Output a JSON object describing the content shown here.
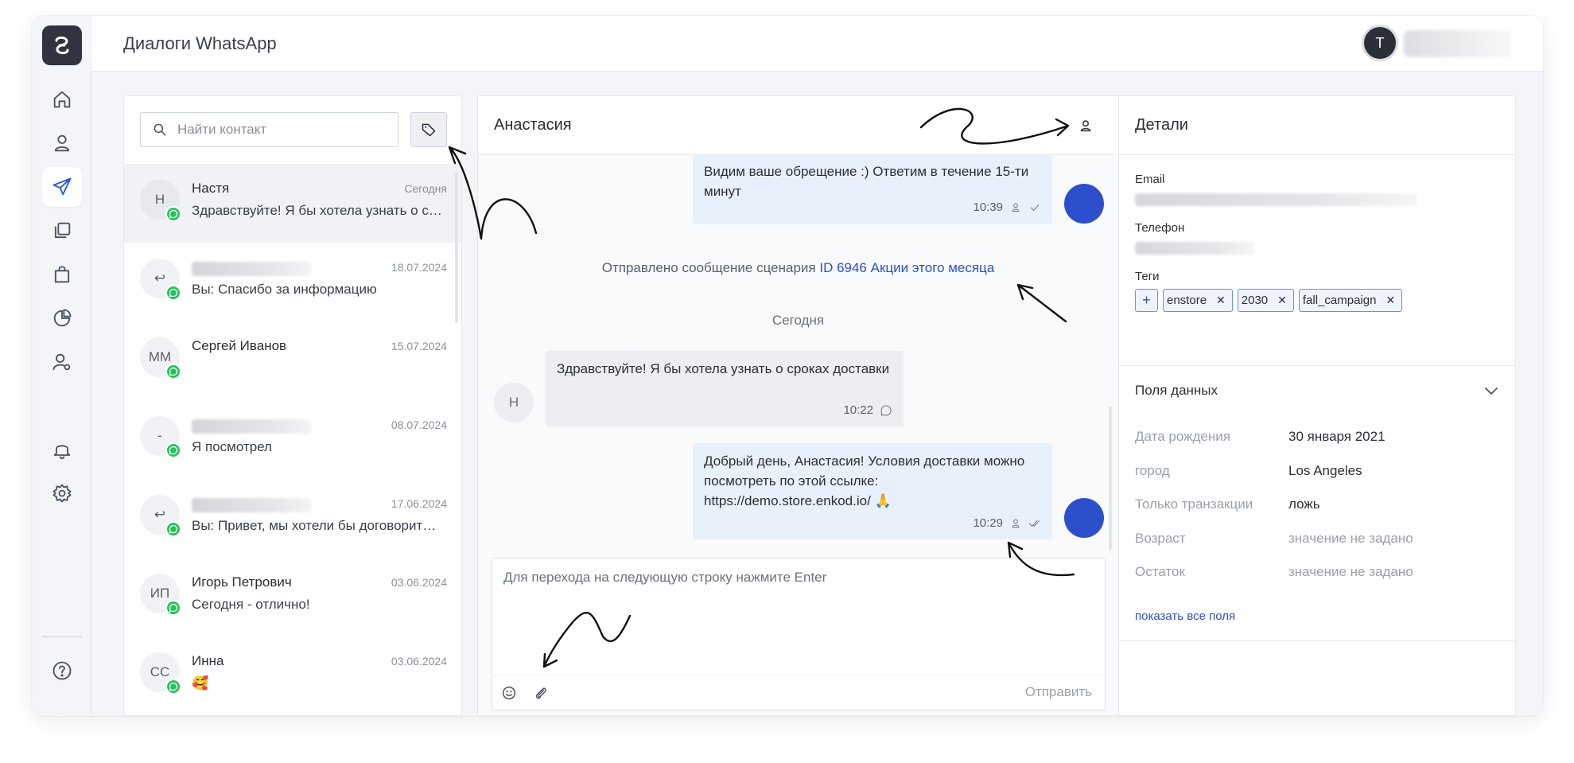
{
  "app": {
    "page_title": "Диалоги WhatsApp",
    "user_initial": "T"
  },
  "sidebar": {
    "items": [
      {
        "icon": "home-icon"
      },
      {
        "icon": "user-icon"
      },
      {
        "icon": "send-icon",
        "active": true
      },
      {
        "icon": "copy-icon"
      },
      {
        "icon": "shopping-bag-icon"
      },
      {
        "icon": "pie-chart-icon"
      },
      {
        "icon": "user-settings-icon"
      },
      {
        "icon": "bell-icon"
      },
      {
        "icon": "gear-icon"
      },
      {
        "icon": "help-icon"
      }
    ]
  },
  "contacts": {
    "search_placeholder": "Найти контакт",
    "items": [
      {
        "avatar": "Н",
        "name": "Настя",
        "date": "Сегодня",
        "preview": "Здравствуйте! Я бы хотела узнать о сроках доставки"
      },
      {
        "avatar": "↩",
        "name": "",
        "date": "18.07.2024",
        "preview": "Вы: Спасибо за информацию"
      },
      {
        "avatar": "ММ",
        "name": "Сергей Иванов",
        "date": "15.07.2024",
        "preview": ""
      },
      {
        "avatar": "-",
        "name": "",
        "date": "08.07.2024",
        "preview": "Я посмотрел"
      },
      {
        "avatar": "↩",
        "name": "",
        "date": "17.06.2024",
        "preview": "Вы: Привет, мы хотели бы договориться"
      },
      {
        "avatar": "ИП",
        "name": "Игорь Петрович",
        "date": "03.06.2024",
        "preview": "Сегодня - отлично!"
      },
      {
        "avatar": "СС",
        "name": "Инна",
        "date": "03.06.2024",
        "preview": "🥰"
      }
    ]
  },
  "chat": {
    "title": "Анастасия",
    "messages": {
      "m1": {
        "text": "Видим ваше обрещение :) Ответим в течение 15-ти минут",
        "time": "10:39"
      },
      "system": {
        "prefix": "Отправлено сообщение сценария",
        "link": "ID 6946 Акции этого месяца"
      },
      "day": "Сегодня",
      "m2": {
        "avatar": "Н",
        "text": "Здравствуйте! Я бы хотела узнать о сроках доставки",
        "time": "10:22"
      },
      "m3": {
        "text": "Добрый день, Анастасия! Условия доставки можно посмотреть по этой ссылке: https://demo.store.enkod.io/ 🙏",
        "time": "10:29"
      }
    },
    "composer_placeholder": "Для перехода на следующую строку нажмите Enter",
    "send_label": "Отправить"
  },
  "details": {
    "title": "Детали",
    "email_label": "Email",
    "phone_label": "Телефон",
    "tags_label": "Теги",
    "tags": [
      "enstore",
      "2030",
      "fall_campaign"
    ],
    "fields_title": "Поля данных",
    "fields": [
      {
        "key": "Дата рождения",
        "value": "30 января 2021",
        "empty": false
      },
      {
        "key": "город",
        "value": "Los Angeles",
        "empty": false
      },
      {
        "key": "Только транзакции",
        "value": "ложь",
        "empty": false
      },
      {
        "key": "Возраст",
        "value": "значение не задано",
        "empty": true
      },
      {
        "key": "Остаток",
        "value": "значение не задано",
        "empty": true
      }
    ],
    "show_all": "показать все поля"
  },
  "colors": {
    "accent": "#2d4fcb",
    "whatsapp": "#25c35a",
    "outgoing_bubble": "#e8f0fc",
    "incoming_bubble": "#eceef1"
  }
}
